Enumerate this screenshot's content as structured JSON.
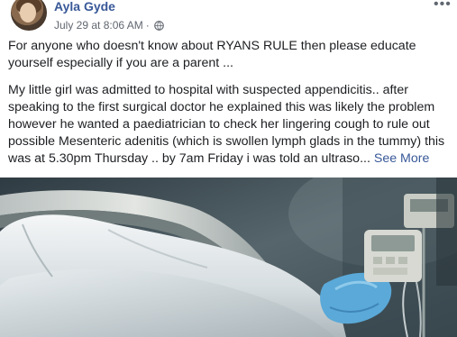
{
  "post": {
    "author": "Ayla Gyde",
    "timestamp": "July 29 at 8:06 AM",
    "separator": "·",
    "privacy_icon": "globe-icon",
    "more_icon": "more-options-icon",
    "paragraphs": [
      "For anyone who doesn't know about RYANS RULE then please educate yourself especially if you are a parent ...",
      "My little girl was admitted to hospital with suspected appendicitis.. after speaking to the first surgical doctor he explained this was likely the problem however he wanted a paediatrician to check her lingering cough to rule out possible Mesenteric adenitis (which is swollen lymph glads in the tummy) this was at 5.30pm Thursday .. by 7am Friday i was told an ultraso..."
    ],
    "see_more": "See More"
  },
  "photo": {
    "subject": "hospital-bed-photo"
  },
  "colors": {
    "link": "#385898",
    "meta": "#616770",
    "text": "#1c1e21"
  }
}
